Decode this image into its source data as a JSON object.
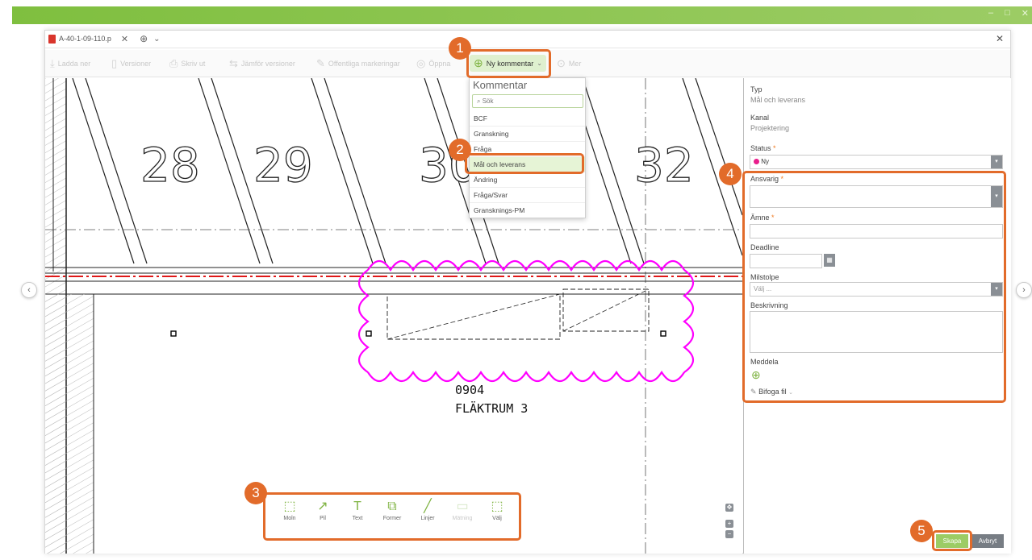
{
  "window": {
    "controls": [
      "–",
      "□",
      "✕"
    ]
  },
  "tab": {
    "title": "A-40-1-09-110.p",
    "close": "✕",
    "add": "⊕",
    "more": "⌄",
    "window_close": "✕"
  },
  "toolbar": {
    "download": "Ladda ner",
    "versions": "Versioner",
    "print": "Skriv ut",
    "compare": "Jämför versioner",
    "public_marks": "Offentliga markeringar",
    "open": "Öppna",
    "new_comment": "Ny kommentar",
    "more": "Mer"
  },
  "dropdown": {
    "title": "Kommentar",
    "search_placeholder": "Sök",
    "items": [
      "BCF",
      "Granskning",
      "Fråga",
      "Mål och leverans",
      "Ändring",
      "Fråga/Svar",
      "Gransknings-PM"
    ],
    "selected": "Mål och leverans"
  },
  "drawing": {
    "numbers": [
      "28",
      "29",
      "30",
      "32"
    ],
    "room_number": "0904",
    "room_name": "FLÄKTRUM 3"
  },
  "draw_tools": [
    {
      "label": "Moln",
      "icon": "cloud-icon",
      "glyph": "⬚",
      "enabled": true
    },
    {
      "label": "Pil",
      "icon": "arrow-icon",
      "glyph": "↗",
      "enabled": true
    },
    {
      "label": "Text",
      "icon": "text-icon",
      "glyph": "T",
      "enabled": true
    },
    {
      "label": "Former",
      "icon": "shapes-icon",
      "glyph": "⧉",
      "enabled": true
    },
    {
      "label": "Linjer",
      "icon": "line-icon",
      "glyph": "╱",
      "enabled": true
    },
    {
      "label": "Mätning",
      "icon": "ruler-icon",
      "glyph": "▭",
      "enabled": false
    },
    {
      "label": "Välj",
      "icon": "select-icon",
      "glyph": "⬚",
      "enabled": true
    }
  ],
  "panel": {
    "type_label": "Typ",
    "type_value": "Mål och leverans",
    "channel_label": "Kanal",
    "channel_value": "Projektering",
    "status_label": "Status",
    "status_value": "Ny",
    "responsible_label": "Ansvarig",
    "subject_label": "Ämne",
    "deadline_label": "Deadline",
    "milestone_label": "Milstolpe",
    "milestone_placeholder": "Välj ...",
    "description_label": "Beskrivning",
    "notify_label": "Meddela",
    "attach_label": "Bifoga fil",
    "required_mark": "*"
  },
  "buttons": {
    "create": "Skapa",
    "cancel": "Avbryt"
  },
  "callouts": [
    "1",
    "2",
    "3",
    "4",
    "5"
  ],
  "colors": {
    "accent_green": "#7fb342",
    "callout_orange": "#e26b2a",
    "markup_magenta": "#ff00ff",
    "status_pink": "#e91e8c"
  }
}
